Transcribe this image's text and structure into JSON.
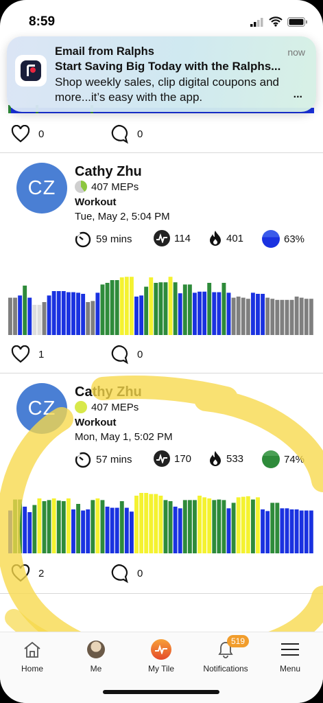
{
  "status_bar": {
    "time": "8:59"
  },
  "notification": {
    "title": "Email from Ralphs",
    "time": "now",
    "subject": "Start Saving Big Today with the Ralphs...",
    "body": "Shop weekly sales, clip digital coupons and more...it’s easy with the app.",
    "more": "..."
  },
  "top_post": {
    "likes": "0",
    "comments": "0"
  },
  "posts": [
    {
      "initials": "CZ",
      "name": "Cathy Zhu",
      "meps": "407 MEPs",
      "meps_color": "#8cc63f",
      "type": "Workout",
      "date": "Tue, May 2, 5:04 PM",
      "duration": "59 mins",
      "heart_rate": "114",
      "calories": "401",
      "effort": "63%",
      "effort_color": "#1a3fe0",
      "likes": "1",
      "comments": "0",
      "zones": [
        "gray",
        "gray",
        "blue",
        "green",
        "blue",
        "lightgray",
        "lightgray",
        "gray",
        "blue",
        "blue",
        "blue",
        "blue",
        "blue",
        "blue",
        "blue",
        "blue",
        "gray",
        "gray",
        "blue",
        "green",
        "green",
        "green",
        "green",
        "yellow",
        "yellow",
        "yellow",
        "blue",
        "blue",
        "green",
        "yellow",
        "green",
        "green",
        "green",
        "yellow",
        "green",
        "blue",
        "green",
        "green",
        "blue",
        "blue",
        "blue",
        "green",
        "blue",
        "blue",
        "green",
        "blue",
        "gray",
        "gray",
        "gray",
        "gray",
        "blue",
        "blue",
        "blue",
        "gray",
        "gray",
        "gray",
        "gray",
        "gray",
        "gray",
        "gray",
        "gray",
        "gray",
        "gray"
      ],
      "levels": [
        0.68,
        0.68,
        0.72,
        0.9,
        0.68,
        0.55,
        0.55,
        0.6,
        0.72,
        0.8,
        0.8,
        0.8,
        0.78,
        0.78,
        0.77,
        0.75,
        0.6,
        0.62,
        0.77,
        0.92,
        0.95,
        1.0,
        1.0,
        1.05,
        1.06,
        1.06,
        0.7,
        0.72,
        0.88,
        1.05,
        0.95,
        0.96,
        0.96,
        1.06,
        0.96,
        0.76,
        0.92,
        0.92,
        0.77,
        0.79,
        0.79,
        0.95,
        0.78,
        0.78,
        0.95,
        0.77,
        0.68,
        0.7,
        0.68,
        0.66,
        0.77,
        0.75,
        0.75,
        0.68,
        0.66,
        0.64,
        0.64,
        0.64,
        0.64,
        0.7,
        0.68,
        0.66,
        0.66
      ]
    },
    {
      "initials": "CZ",
      "name": "Cathy Zhu",
      "meps": "407 MEPs",
      "meps_color": "#d8e84a",
      "type": "Workout",
      "date": "Mon, May 1, 5:02 PM",
      "duration": "57 mins",
      "heart_rate": "170",
      "calories": "533",
      "effort": "74%",
      "effort_color": "#2e8b3a",
      "likes": "2",
      "comments": "0",
      "zones": [
        "blue",
        "green",
        "green",
        "blue",
        "blue",
        "green",
        "yellow",
        "green",
        "green",
        "yellow",
        "green",
        "green",
        "yellow",
        "blue",
        "green",
        "blue",
        "blue",
        "green",
        "yellow",
        "green",
        "blue",
        "blue",
        "blue",
        "green",
        "blue",
        "blue",
        "yellow",
        "yellow",
        "yellow",
        "yellow",
        "yellow",
        "yellow",
        "green",
        "green",
        "blue",
        "blue",
        "green",
        "green",
        "green",
        "yellow",
        "yellow",
        "yellow",
        "green",
        "green",
        "green",
        "blue",
        "green",
        "yellow",
        "yellow",
        "yellow",
        "green",
        "yellow",
        "blue",
        "blue",
        "green",
        "green",
        "blue",
        "blue",
        "blue",
        "blue",
        "blue",
        "blue",
        "blue"
      ],
      "levels": [
        0.78,
        0.98,
        0.98,
        0.85,
        0.75,
        0.88,
        1.0,
        0.95,
        0.97,
        1.0,
        0.96,
        0.95,
        1.0,
        0.8,
        0.9,
        0.78,
        0.8,
        0.97,
        1.0,
        0.97,
        0.85,
        0.83,
        0.83,
        0.95,
        0.83,
        0.76,
        1.05,
        1.1,
        1.1,
        1.08,
        1.08,
        1.05,
        0.97,
        0.95,
        0.85,
        0.82,
        0.97,
        0.97,
        0.97,
        1.05,
        1.02,
        1.0,
        0.97,
        0.98,
        0.97,
        0.82,
        0.92,
        1.02,
        1.03,
        1.04,
        0.98,
        1.02,
        0.8,
        0.77,
        0.92,
        0.92,
        0.82,
        0.82,
        0.8,
        0.8,
        0.78,
        0.78,
        0.78
      ]
    }
  ],
  "colors": {
    "blue": "#1a32e0",
    "green": "#2e8b3a",
    "yellow": "#f4f230",
    "gray": "#7f7f7f",
    "lightgray": "#dddddd",
    "highlight": "#f7d84a"
  },
  "tabs": [
    {
      "label": "Home",
      "icon": "home-icon"
    },
    {
      "label": "Me",
      "icon": "profile-avatar-icon"
    },
    {
      "label": "My Tile",
      "icon": "my-tile-icon"
    },
    {
      "label": "Notifications",
      "icon": "bell-icon",
      "badge": "519"
    },
    {
      "label": "Menu",
      "icon": "hamburger-menu-icon"
    }
  ]
}
